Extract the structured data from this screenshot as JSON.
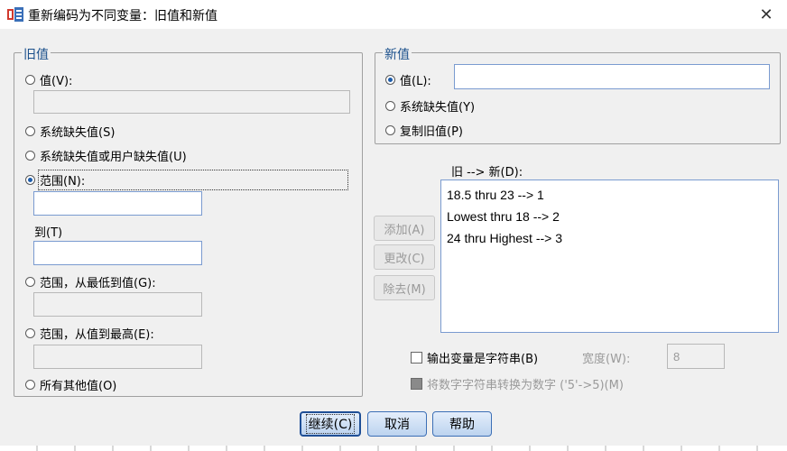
{
  "window": {
    "title": "重新编码为不同变量：旧值和新值",
    "close_icon": "close-icon",
    "app_icon": "spss-recode-icon"
  },
  "old": {
    "legend": "旧值",
    "value_label": "值(V):",
    "value_input": "",
    "sysmis_label": "系统缺失值(S)",
    "sysmis_user_label": "系统缺失值或用户缺失值(U)",
    "range_label": "范围(N):",
    "range_from": "",
    "to_label": "到(T)",
    "range_to": "",
    "range_low_label": "范围，从最低到值(G):",
    "range_low_input": "",
    "range_high_label": "范围，从值到最高(E):",
    "range_high_input": "",
    "else_label": "所有其他值(O)",
    "selected": "range"
  },
  "new": {
    "legend": "新值",
    "value_label": "值(L):",
    "value_input": "",
    "sysmis_label": "系统缺失值(Y)",
    "copy_label": "复制旧值(P)",
    "selected": "value"
  },
  "mapping": {
    "label": "旧 --> 新(D):",
    "items": [
      "18.5 thru 23 --> 1",
      "Lowest thru 18 --> 2",
      "24 thru Highest --> 3"
    ]
  },
  "actions": {
    "add": "添加(A)",
    "change": "更改(C)",
    "remove": "除去(M)"
  },
  "options": {
    "string_output_label": "输出变量是字符串(B)",
    "string_output_checked": false,
    "width_label": "宽度(W):",
    "width_value": "8",
    "convert_label": "将数字字符串转换为数字 ('5'->5)(M)",
    "convert_checked": false
  },
  "buttons": {
    "continue": "继续(C)",
    "cancel": "取消",
    "help": "帮助"
  },
  "colors": {
    "accent": "#1e5dab",
    "legend": "#1a4f8b",
    "background": "#f0f0f0"
  }
}
